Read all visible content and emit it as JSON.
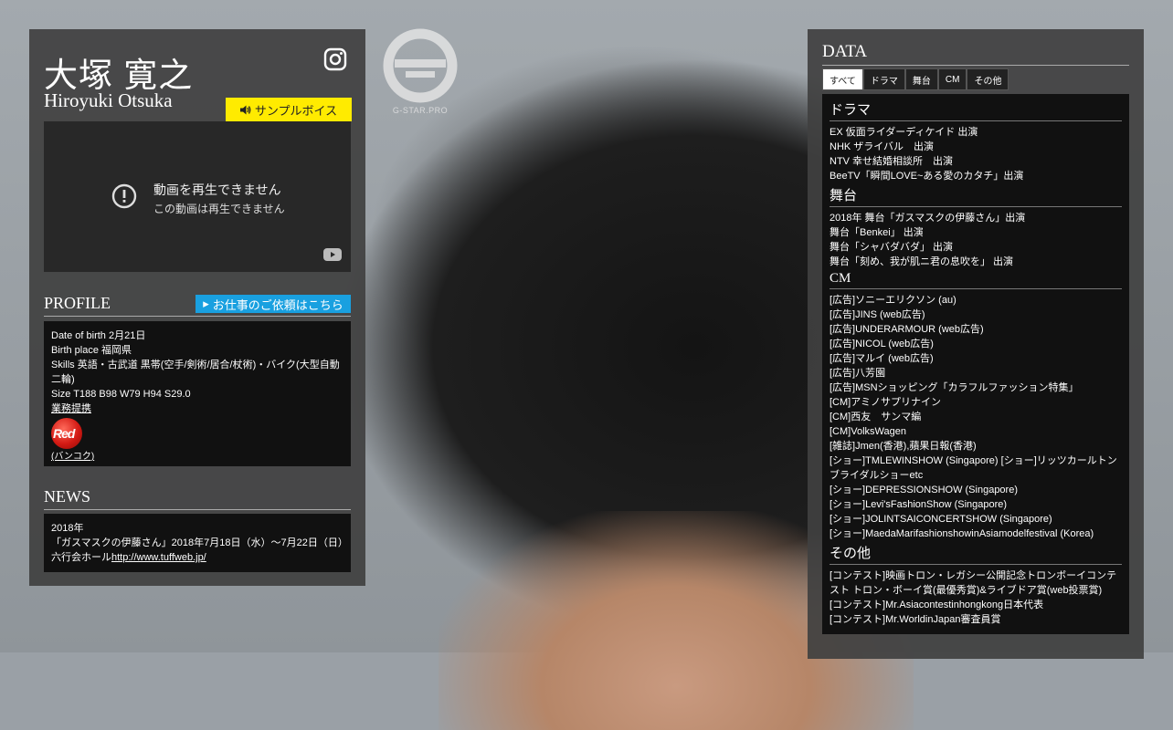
{
  "logo": {
    "text": "G-STAR.PRO"
  },
  "profile_header": {
    "name_ja": "大塚 寛之",
    "name_en": "Hiroyuki Otsuka",
    "sample_voice_label": "サンプルボイス"
  },
  "video": {
    "error_title": "動画を再生できません",
    "error_sub": "この動画は再生できません"
  },
  "profile": {
    "title": "PROFILE",
    "contact_label": "お仕事のご依頼はこちら",
    "dob": "Date of birth 2月21日",
    "birthplace": "Birth place 福岡県",
    "skills": "Skills 英語・古武道 黒帯(空手/剣術/居合/杖術)・バイク(大型自動二輪)",
    "size": "Size T188 B98 W79 H94 S29.0",
    "partner_link": "業務提携",
    "partner_logo_text": "Red",
    "partner_city": "(バンコク)"
  },
  "news": {
    "title": "NEWS",
    "year": "2018年",
    "item_text": "「ガスマスクの伊藤さん」2018年7月18日（水）〜7月22日（日）　六行会ホール",
    "item_link": "http://www.tuffweb.jp/"
  },
  "data_panel": {
    "title": "DATA",
    "tabs": [
      "すべて",
      "ドラマ",
      "舞台",
      "CM",
      "その他"
    ],
    "active_tab": "すべて",
    "drama": {
      "title": "ドラマ",
      "items": [
        "EX 仮面ライダーディケイド 出演",
        "NHK ザライバル　出演",
        "NTV 幸せ結婚相談所　出演",
        "BeeTV「瞬間LOVE~ある愛のカタチ」出演"
      ]
    },
    "stage": {
      "title": "舞台",
      "items": [
        "2018年 舞台「ガスマスクの伊藤さん」出演",
        "舞台「Benkei」 出演",
        "舞台「シャバダバダ」 出演",
        "舞台「刻め、我が肌ニ君の息吹を」 出演"
      ]
    },
    "cm": {
      "title": "CM",
      "items": [
        "[広告]ソニーエリクソン (au)",
        "[広告]JINS (web広告)",
        "[広告]UNDERARMOUR (web広告)",
        "[広告]NICOL (web広告)",
        "[広告]マルイ (web広告)",
        "[広告]八芳園",
        "[広告]MSNショッピング「カラフルファッション特集」",
        "[CM]アミノサプリナイン",
        "[CM]西友　サンマ編",
        "[CM]VolksWagen",
        "[雑誌]Jmen(香港),蘋果日報(香港)",
        "[ショー]TMLEWINSHOW (Singapore) [ショー]リッツカールトンブライダルショーetc",
        "[ショー]DEPRESSIONSHOW (Singapore)",
        "[ショー]Levi'sFashionShow (Singapore)",
        "[ショー]JOLINTSAICONCERTSHOW (Singapore)",
        "[ショー]MaedaMarifashionshowinAsiamodelfestival (Korea)"
      ]
    },
    "other": {
      "title": "その他",
      "items": [
        "[コンテスト]映画トロン・レガシー公開記念トロンボーイコンテスト トロン・ボーイ賞(最優秀賞)&ライブドア賞(web投票賞)",
        "[コンテスト]Mr.Asiacontestinhongkong日本代表",
        "[コンテスト]Mr.WorldinJapan審査員賞"
      ]
    }
  },
  "colors": {
    "accent_yellow": "#ffeb00",
    "accent_blue": "#19a0e0",
    "panel_bg": "#404040",
    "box_bg": "#111111"
  }
}
